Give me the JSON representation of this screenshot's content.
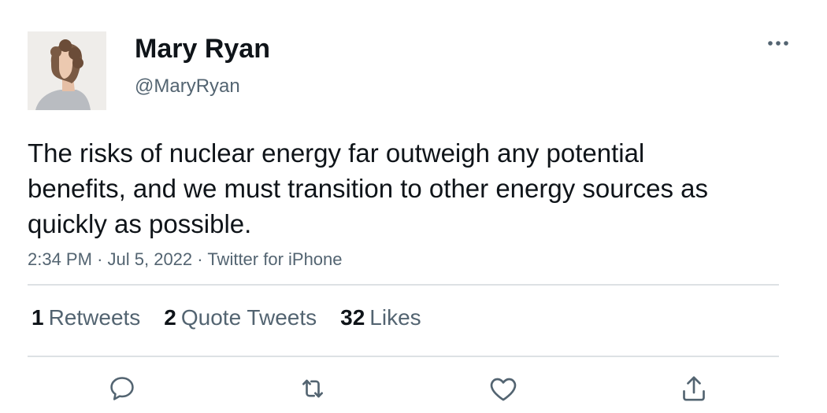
{
  "author": {
    "display_name": "Mary Ryan",
    "handle": "@MaryRyan"
  },
  "tweet": {
    "text": "The risks of nuclear energy far outweigh any potential benefits, and we must transition to other energy sources as quickly as possible.",
    "time": "2:34 PM",
    "date": "Jul 5, 2022",
    "source": "Twitter for iPhone",
    "separator": "·"
  },
  "stats": {
    "retweets_count": "1",
    "retweets_label": "Retweets",
    "quotes_count": "2",
    "quotes_label": "Quote Tweets",
    "likes_count": "32",
    "likes_label": "Likes"
  },
  "icons": {
    "more": "more-horizontal-icon",
    "reply": "reply-icon",
    "retweet": "retweet-icon",
    "like": "heart-icon",
    "share": "share-icon"
  },
  "colors": {
    "text_primary": "#0f1419",
    "text_secondary": "#536471",
    "divider": "#dde1e4"
  }
}
